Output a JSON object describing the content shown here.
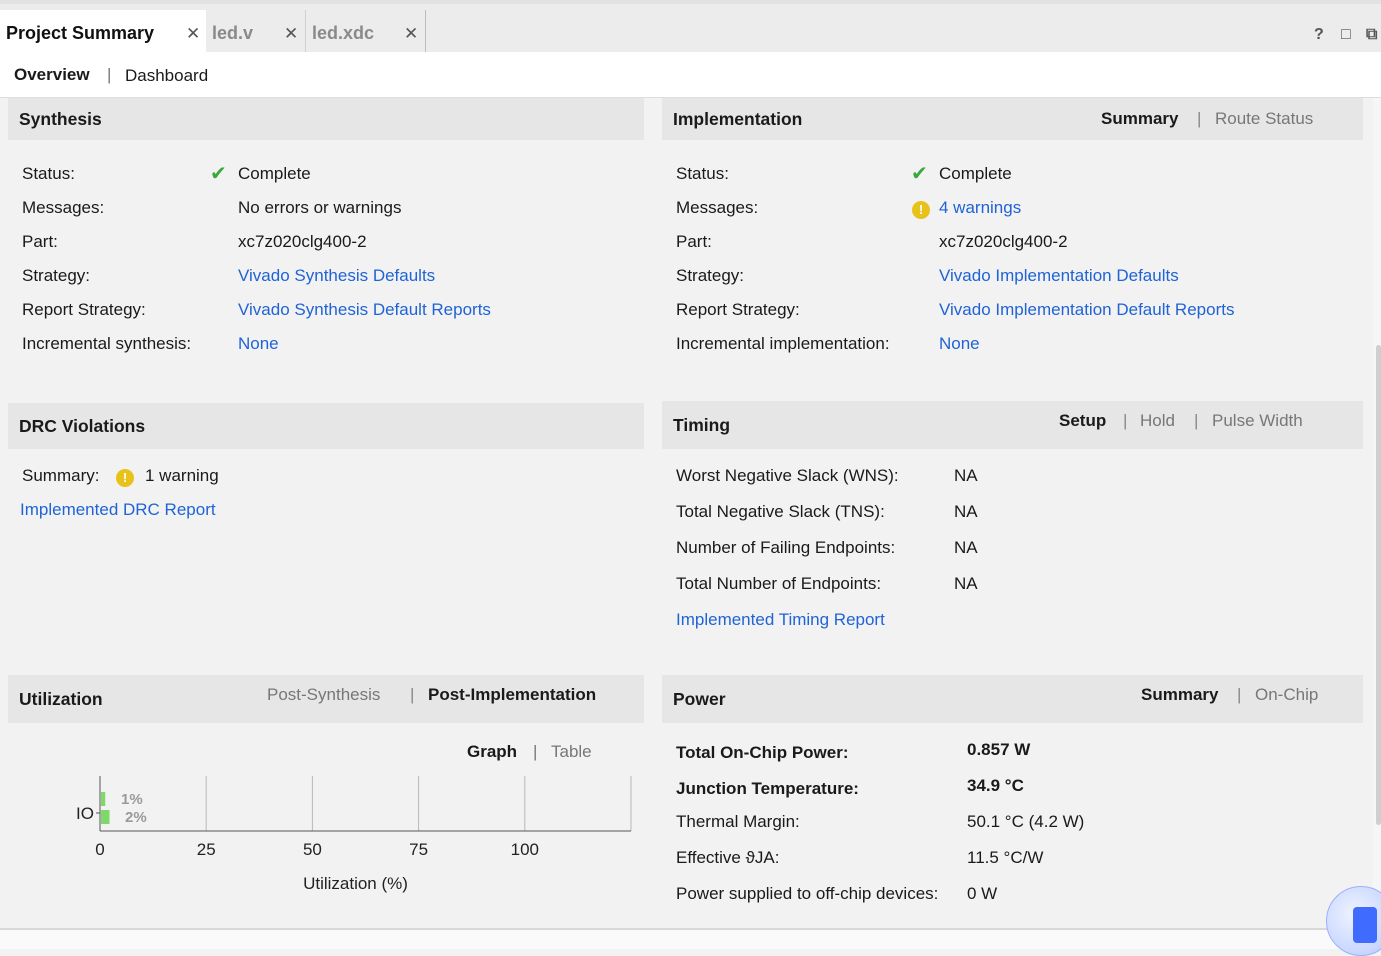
{
  "tabs": [
    {
      "label": "Project Summary"
    },
    {
      "label": "led.v"
    },
    {
      "label": "led.xdc"
    }
  ],
  "window_controls": {
    "help": "?",
    "restore": "□",
    "float": "⧉"
  },
  "subtabs": {
    "overview": "Overview",
    "sep": "|",
    "dashboard": "Dashboard"
  },
  "synthesis": {
    "title": "Synthesis",
    "rows": [
      {
        "label": "Status:",
        "value": "Complete"
      },
      {
        "label": "Messages:",
        "value": "No errors or warnings"
      },
      {
        "label": "Part:",
        "value": "xc7z020clg400-2"
      },
      {
        "label": "Strategy:",
        "value": "Vivado Synthesis Defaults"
      },
      {
        "label": "Report Strategy:",
        "value": "Vivado Synthesis Default Reports"
      },
      {
        "label": "Incremental synthesis:",
        "value": "None"
      }
    ]
  },
  "implementation": {
    "title": "Implementation",
    "opt_summary": "Summary",
    "opt_route": "Route Status",
    "rows": [
      {
        "label": "Status:",
        "value": "Complete"
      },
      {
        "label": "Messages:",
        "value": "4 warnings"
      },
      {
        "label": "Part:",
        "value": "xc7z020clg400-2"
      },
      {
        "label": "Strategy:",
        "value": "Vivado Implementation Defaults"
      },
      {
        "label": "Report Strategy:",
        "value": "Vivado Implementation Default Reports"
      },
      {
        "label": "Incremental implementation:",
        "value": "None"
      }
    ]
  },
  "drc": {
    "title": "DRC Violations",
    "summary_label": "Summary:",
    "summary_value": "1 warning",
    "report_link": "Implemented DRC Report"
  },
  "timing": {
    "title": "Timing",
    "opt_setup": "Setup",
    "opt_hold": "Hold",
    "opt_pulse": "Pulse Width",
    "rows": [
      {
        "label": "Worst Negative Slack (WNS):",
        "value": "NA"
      },
      {
        "label": "Total Negative Slack (TNS):",
        "value": "NA"
      },
      {
        "label": "Number of Failing Endpoints:",
        "value": "NA"
      },
      {
        "label": "Total Number of Endpoints:",
        "value": "NA"
      }
    ],
    "report_link": "Implemented Timing Report"
  },
  "utilization": {
    "title": "Utilization",
    "opt_post_synth": "Post-Synthesis",
    "opt_post_impl": "Post-Implementation",
    "opt_graph": "Graph",
    "opt_table": "Table"
  },
  "power": {
    "title": "Power",
    "opt_summary": "Summary",
    "opt_onchip": "On-Chip",
    "rows": [
      {
        "label": "Total On-Chip Power:",
        "value": "0.857 W"
      },
      {
        "label": "Junction Temperature:",
        "value": "34.9 °C"
      },
      {
        "label": "Thermal Margin:",
        "value": "50.1 °C (4.2 W)"
      },
      {
        "label": "Effective ϑJA:",
        "value": "11.5 °C/W"
      },
      {
        "label": "Power supplied to off-chip devices:",
        "value": "0 W"
      }
    ]
  },
  "chart_data": {
    "type": "bar",
    "orientation": "horizontal",
    "categories": [
      "IO"
    ],
    "series": [
      {
        "values": [
          1
        ],
        "label": "1%",
        "color": "#7fd86a"
      },
      {
        "values": [
          2
        ],
        "label": "2%",
        "color": "#7fd86a"
      }
    ],
    "xlabel": "Utilization (%)",
    "xlim": [
      0,
      125
    ],
    "xticks": [
      "0",
      "25",
      "50",
      "75",
      "100"
    ],
    "grid": true
  },
  "colors": {
    "link": "#1f63d6",
    "check": "#3aa83a",
    "warning": "#e8c21a",
    "header_bg": "#e6e6e6"
  }
}
